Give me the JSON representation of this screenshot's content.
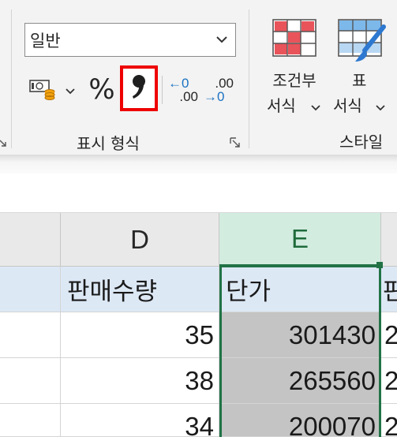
{
  "ribbon": {
    "number_group": {
      "format_dropdown": {
        "value": "일반"
      },
      "percent_label": "%",
      "comma_label": ",",
      "increase_decimal": {
        "top": "←0",
        "bottom": ".00"
      },
      "decrease_decimal": {
        "top": ".00",
        "bottom": "→0"
      },
      "group_label": "표시 형식"
    },
    "styles_group": {
      "conditional_formatting": {
        "line1": "조건부",
        "line2": "서식"
      },
      "format_as_table": {
        "line1": "표",
        "line2": "서식"
      },
      "group_label": "스타일"
    },
    "colors": {
      "highlight": "#ee0000",
      "accent": "#217346"
    }
  },
  "sheet": {
    "columns": [
      {
        "label": "D",
        "selected": false
      },
      {
        "label": "E",
        "selected": true
      }
    ],
    "header_row": {
      "d": "판매수량",
      "e": "단가",
      "f": "판"
    },
    "rows": [
      {
        "d": "35",
        "e": "301430",
        "f": "2"
      },
      {
        "d": "38",
        "e": "265560",
        "f": "2"
      },
      {
        "d": "34",
        "e": "200070",
        "f": "2"
      }
    ]
  }
}
